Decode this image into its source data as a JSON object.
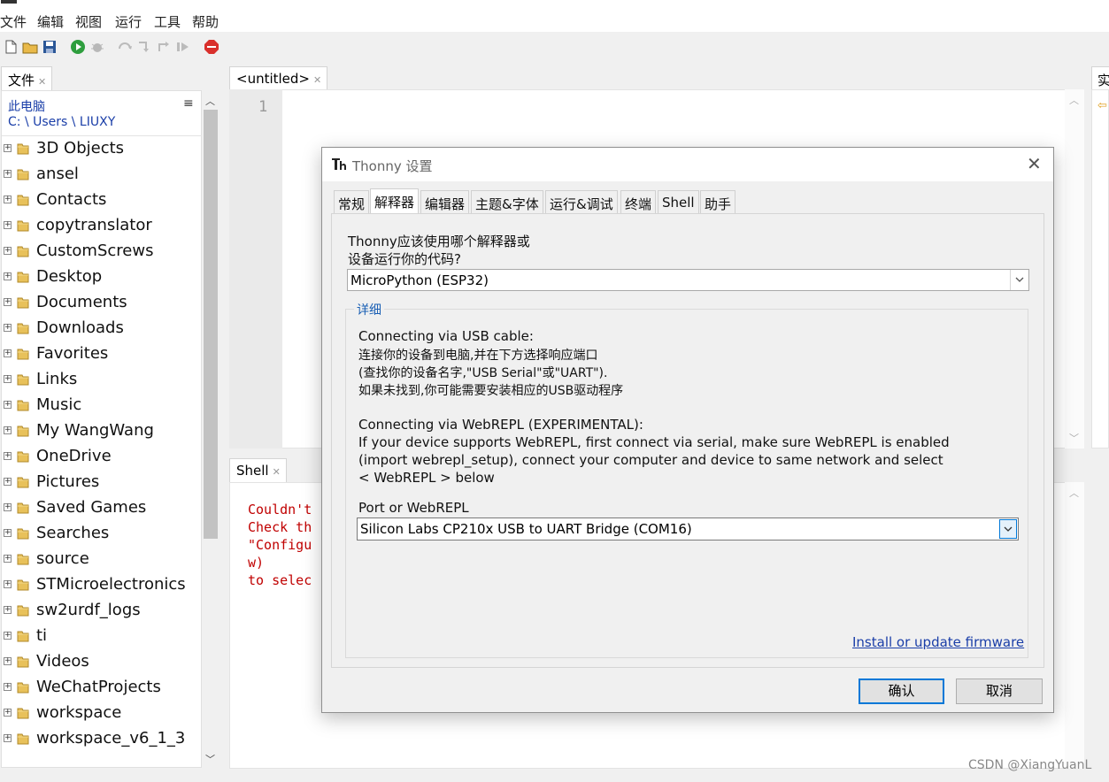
{
  "menu": [
    "文件",
    "编辑",
    "视图",
    "运行",
    "工具",
    "帮助"
  ],
  "files_tab": {
    "label": "文件"
  },
  "file_panel": {
    "location": "此电脑",
    "path": "C: \\ Users \\ LIUXY",
    "menu_glyph": "≡",
    "items": [
      "3D Objects",
      "ansel",
      "Contacts",
      "copytranslator",
      "CustomScrews",
      "Desktop",
      "Documents",
      "Downloads",
      "Favorites",
      "Links",
      "Music",
      "My WangWang",
      "OneDrive",
      "Pictures",
      "Saved Games",
      "Searches",
      "source",
      "STMicroelectronics",
      "sw2urdf_logs",
      "ti",
      "Videos",
      "WeChatProjects",
      "workspace",
      "workspace_v6_1_3"
    ]
  },
  "editor": {
    "tab": "<untitled>",
    "line_number": "1"
  },
  "right_panel": {
    "tab": "实"
  },
  "shell": {
    "tab": "Shell",
    "lines": [
      "Couldn't",
      "Check th",
      "\"Configu",
      "w)",
      "to selec"
    ]
  },
  "dialog": {
    "title": "Thonny 设置",
    "tabs": [
      "常规",
      "解释器",
      "编辑器",
      "主题&字体",
      "运行&调试",
      "终端",
      "Shell",
      "助手"
    ],
    "active_tab": 1,
    "question_line1": "Thonny应该使用哪个解释器或",
    "question_line2": "设备运行你的代码?",
    "interpreter_value": "MicroPython (ESP32)",
    "details_legend": "详细",
    "usb_lines": [
      "Connecting via USB cable:",
      "连接你的设备到电脑,并在下方选择响应端口",
      "(查找你的设备名字,\"USB Serial\"或\"UART\").",
      "如果未找到,你可能需要安装相应的USB驱动程序"
    ],
    "webrepl_lines": [
      "Connecting via WebREPL (EXPERIMENTAL):",
      "If your device supports WebREPL, first connect via serial, make sure WebREPL is enabled",
      "(import webrepl_setup), connect your computer and device to same network and select",
      "< WebREPL > below"
    ],
    "port_label": "Port or WebREPL",
    "port_value": "Silicon Labs CP210x USB to UART Bridge (COM16)",
    "firmware_link": "Install or update firmware",
    "ok": "确认",
    "cancel": "取消"
  },
  "watermark": "CSDN @XiangYuanL",
  "colors": {
    "link": "#1a3ea8",
    "shell_error": "#c00000",
    "focus_border": "#0078d7"
  }
}
